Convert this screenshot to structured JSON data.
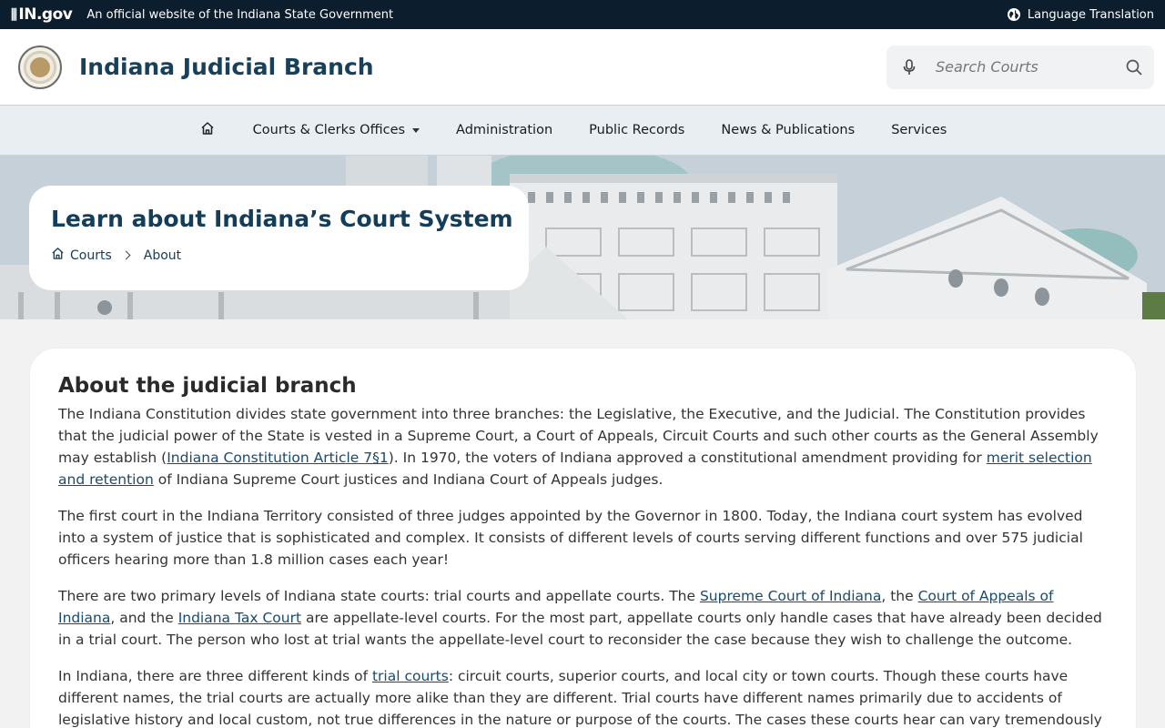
{
  "topbar": {
    "logo_text": "IN.gov",
    "official_text": "An official website of the Indiana State Government",
    "language_label": "Language Translation",
    "globe_icon": "globe-icon"
  },
  "header": {
    "seal_icon": "indiana-state-seal",
    "site_title": "Indiana Judicial Branch",
    "search_placeholder": "Search Courts"
  },
  "nav": {
    "home_icon": "home-icon",
    "items": [
      {
        "label": "Courts & Clerks Offices",
        "has_dropdown": true
      },
      {
        "label": "Administration"
      },
      {
        "label": "Public Records"
      },
      {
        "label": "News & Publications"
      },
      {
        "label": "Services"
      }
    ]
  },
  "hero": {
    "title": "Learn about Indiana’s Court System",
    "breadcrumb": {
      "home_label": "Courts",
      "current_label": "About"
    }
  },
  "article": {
    "heading": "About the judicial branch",
    "p1": {
      "t1": "The Indiana Constitution divides state government into three branches: the Legislative, the Executive, and the Judicial. The Constitution provides that the judicial power of the State is vested in a Supreme Court, a Court of Appeals, Circuit Courts and such other courts as the General Assembly may establish (",
      "link1": "Indiana Constitution Article 7§1",
      "t2": "). In 1970, the voters of Indiana approved a constitutional amendment providing for ",
      "link2": "merit selection and retention",
      "t3": " of Indiana Supreme Court justices and Indiana Court of Appeals judges."
    },
    "p2": "The first court in the Indiana Territory consisted of three judges appointed by the Governor in 1800. Today, the Indiana court system has evolved into a system of justice that is sophisticated and complex. It consists of different levels of courts serving different functions and over 575 judicial officers hearing more than 1.8 million cases each year!",
    "p3": {
      "t1": "There are two primary levels of Indiana state courts: trial courts and appellate courts. The ",
      "link1": "Supreme Court of Indiana",
      "t2": ", the ",
      "link2": "Court of Appeals of Indiana",
      "t3": ", and the ",
      "link3": "Indiana Tax Court",
      "t4": " are appellate-level courts. For the most part, appellate courts only handle cases that have already been decided in a trial court. The person who lost at trial wants the appellate-level court to reconsider the case because they wish to challenge the outcome."
    },
    "p4": {
      "t1": "In Indiana, there are three different kinds of ",
      "link1": "trial courts",
      "t2": ": circuit courts, superior courts, and local city or town courts. Though these courts have different names, the trial courts are actually more alike than they are different. Trial courts have different names primarily due to accidents of legislative history and local custom, not true differences in the nature or purpose of the courts. The cases these courts hear can vary tremendously from county to county."
    }
  }
}
